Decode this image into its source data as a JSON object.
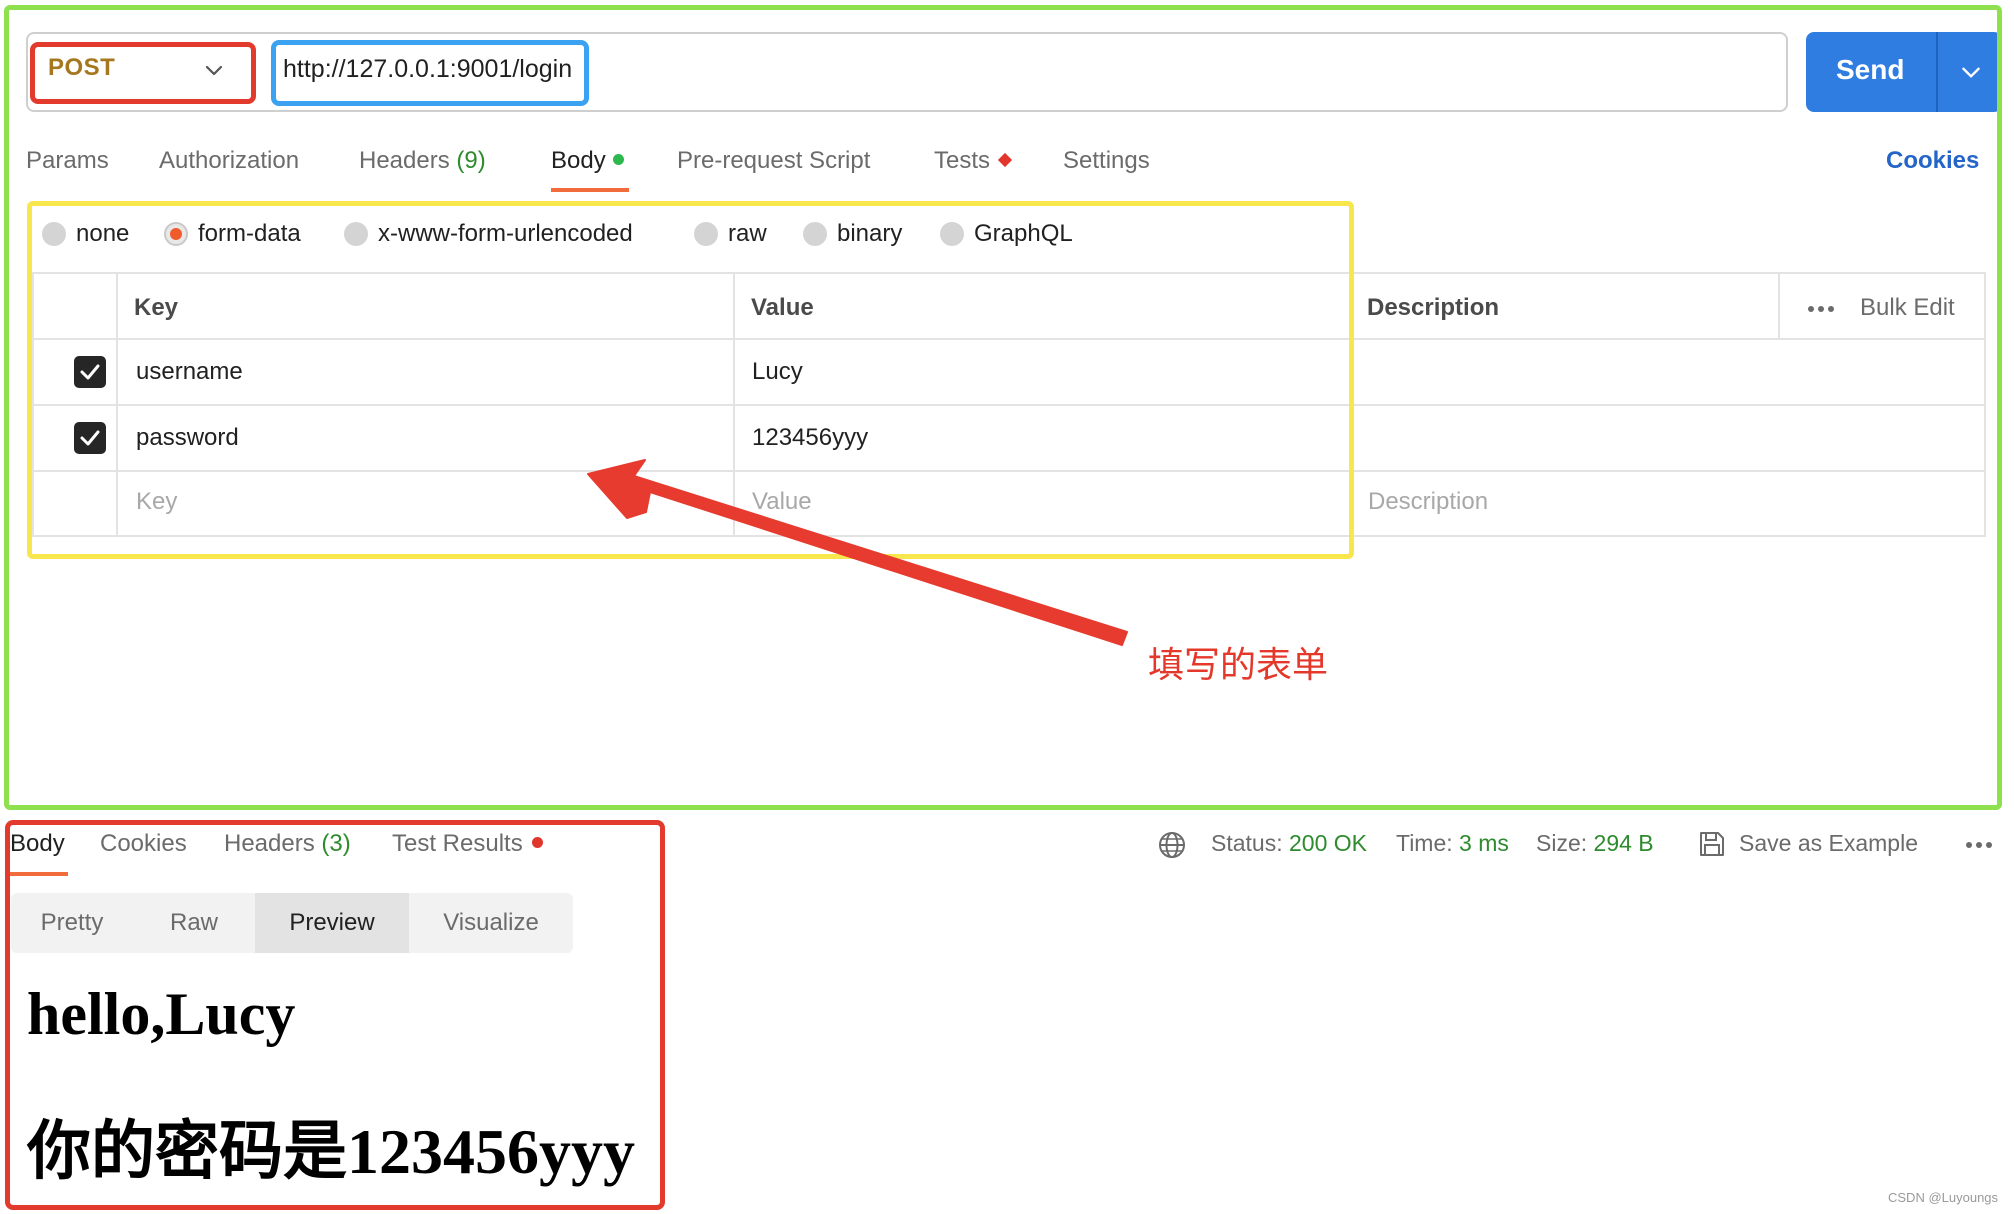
{
  "request": {
    "method": "POST",
    "url": "http://127.0.0.1:9001/login",
    "send_label": "Send"
  },
  "request_tabs": {
    "params": "Params",
    "authorization": "Authorization",
    "headers": "Headers",
    "headers_count": "(9)",
    "body": "Body",
    "pre_request": "Pre-request Script",
    "tests": "Tests",
    "settings": "Settings",
    "cookies": "Cookies"
  },
  "body_types": {
    "none": "none",
    "form_data": "form-data",
    "urlencoded": "x-www-form-urlencoded",
    "raw": "raw",
    "binary": "binary",
    "graphql": "GraphQL",
    "selected": "form-data"
  },
  "form_table": {
    "headers": {
      "key": "Key",
      "value": "Value",
      "description": "Description",
      "bulk_edit": "Bulk Edit"
    },
    "rows": [
      {
        "checked": true,
        "key": "username",
        "value": "Lucy"
      },
      {
        "checked": true,
        "key": "password",
        "value": "123456yyy"
      }
    ],
    "placeholders": {
      "key": "Key",
      "value": "Value",
      "description": "Description"
    }
  },
  "annotation": {
    "caption": "填写的表单"
  },
  "response_tabs": {
    "body": "Body",
    "cookies": "Cookies",
    "headers": "Headers",
    "headers_count": "(3)",
    "test_results": "Test Results"
  },
  "response_status": {
    "status_label": "Status:",
    "status_value": "200 OK",
    "time_label": "Time:",
    "time_value": "3 ms",
    "size_label": "Size:",
    "size_value": "294 B",
    "save_example": "Save as Example"
  },
  "response_view": {
    "modes": [
      "Pretty",
      "Raw",
      "Preview",
      "Visualize"
    ],
    "selected": "Preview"
  },
  "preview": {
    "line1": "hello,Lucy",
    "line2": "你的密码是123456yyy"
  },
  "watermark": "CSDN @Luyoungs",
  "colors": {
    "send_button": "#2f7de1",
    "method_text": "#a5771f",
    "active_tab_underline": "#f26b3a",
    "status_ok": "#2e8b2e",
    "annotation_red": "#e4382b",
    "frame_green": "#8ee04f",
    "frame_yellow": "#f8e64d",
    "frame_blue": "#3aa2f0"
  }
}
